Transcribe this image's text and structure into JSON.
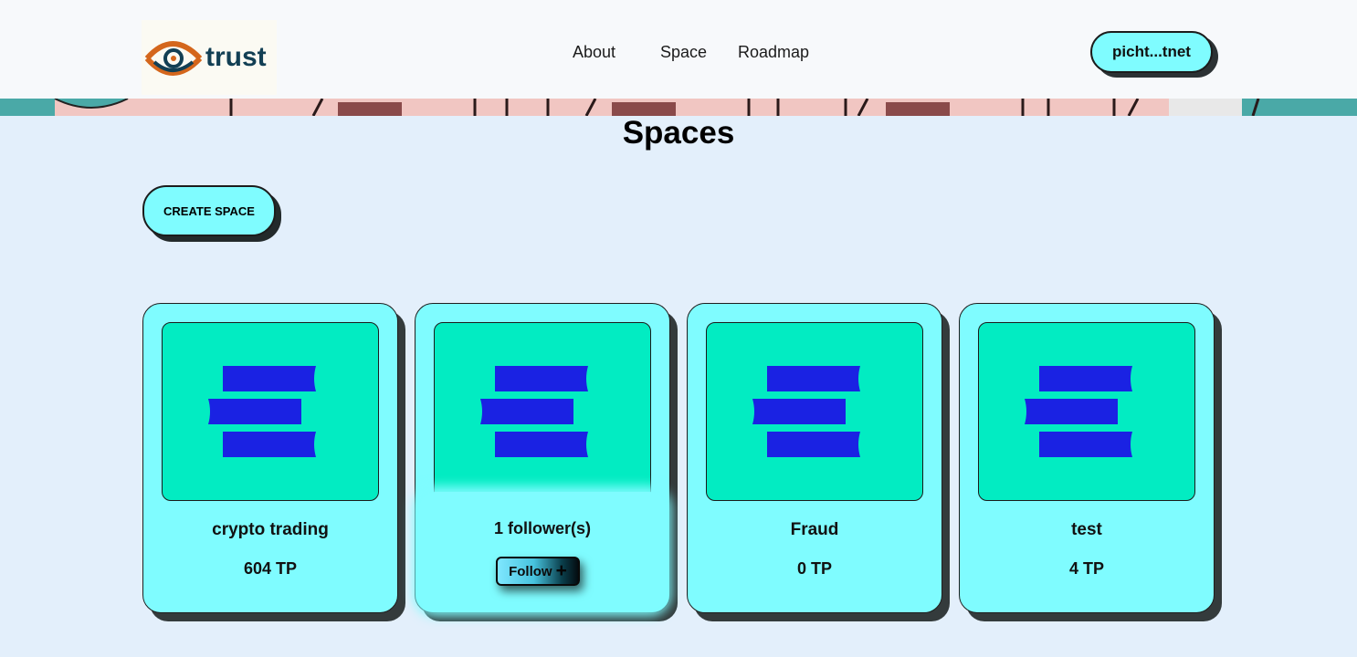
{
  "header": {
    "logo_text": "trust",
    "nav": [
      "About",
      "Space",
      "Roadmap"
    ],
    "wallet_label": "picht...tnet"
  },
  "page": {
    "title": "Spaces",
    "create_label": "CREATE SPACE"
  },
  "cards": [
    {
      "name": "crypto trading",
      "points": "604 TP"
    },
    {
      "followers": "1 follower(s)",
      "follow_label": "Follow",
      "follow_icon": "+"
    },
    {
      "name": "Fraud",
      "points": "0 TP"
    },
    {
      "name": "test",
      "points": "4 TP"
    }
  ],
  "colors": {
    "accent_cyan": "#7ffcff",
    "card_image_bg": "#02ecc2",
    "icon_blue": "#1a22e3",
    "background": "#e3effb"
  }
}
